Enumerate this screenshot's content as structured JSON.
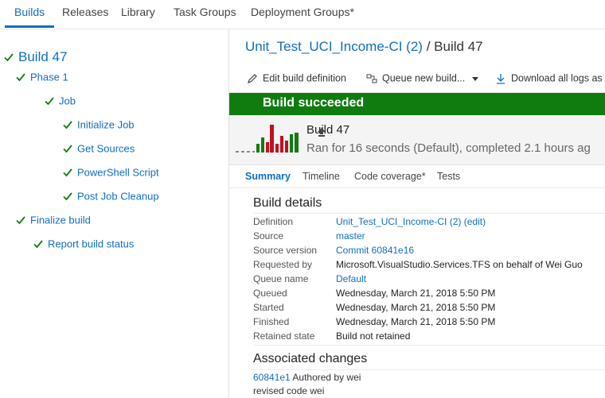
{
  "nav": {
    "tabs": [
      "Builds",
      "Releases",
      "Library",
      "Task Groups",
      "Deployment Groups*"
    ],
    "active": "Builds",
    "accent": "#106ebe"
  },
  "tree": {
    "root": "Build 47",
    "phase": "Phase 1",
    "job": "Job",
    "steps": [
      "Initialize Job",
      "Get Sources",
      "PowerShell Script",
      "Post Job Cleanup"
    ],
    "finalize": "Finalize build",
    "report": "Report build status",
    "status_color": "#107c10"
  },
  "header": {
    "definition_link": "Unit_Test_UCI_Income-CI (2)",
    "separator": "/",
    "build": "Build 47"
  },
  "toolbar": {
    "edit": "Edit build definition",
    "queue": "Queue new build...",
    "download": "Download all logs as z"
  },
  "banner": {
    "text": "Build succeeded",
    "color": "#107c10"
  },
  "summary": {
    "name": "Build 47",
    "description": "Ran for 16 seconds (Default), completed 2.1 hours ag"
  },
  "subtabs": [
    "Summary",
    "Timeline",
    "Code coverage*",
    "Tests"
  ],
  "build_details": {
    "title": "Build details",
    "rows": [
      {
        "key": "Definition",
        "value": "Unit_Test_UCI_Income-CI (2)",
        "suffix": " (edit)",
        "link": true
      },
      {
        "key": "Source",
        "value": "master",
        "link": true
      },
      {
        "key": "Source version",
        "value": "Commit 60841e16",
        "link": true
      },
      {
        "key": "Requested by",
        "value": "Microsoft.VisualStudio.Services.TFS on behalf of Wei Guo",
        "link": false
      },
      {
        "key": "Queue name",
        "value": "Default",
        "link": true
      },
      {
        "key": "Queued",
        "value": "Wednesday, March 21, 2018 5:50 PM",
        "link": false
      },
      {
        "key": "Started",
        "value": "Wednesday, March 21, 2018 5:50 PM",
        "link": false
      },
      {
        "key": "Finished",
        "value": "Wednesday, March 21, 2018 5:50 PM",
        "link": false
      },
      {
        "key": "Retained state",
        "value": "Build not retained",
        "link": false
      }
    ]
  },
  "associated_changes": {
    "title": "Associated changes",
    "commit": "60841e1",
    "author": " Authored by wei",
    "message": "revised code wei"
  }
}
